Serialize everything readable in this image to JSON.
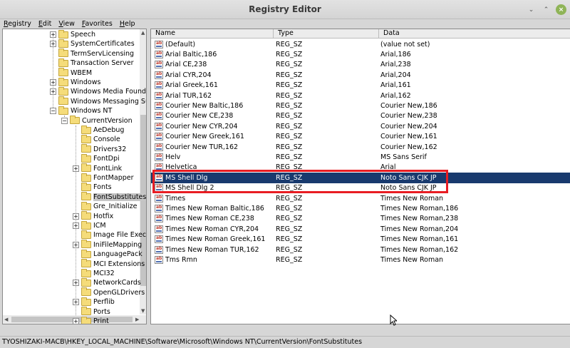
{
  "window": {
    "title": "Registry Editor"
  },
  "menu": [
    "Registry",
    "Edit",
    "View",
    "Favorites",
    "Help"
  ],
  "tree": [
    {
      "label": "Speech",
      "expander": "+",
      "level": 0
    },
    {
      "label": "SystemCertificates",
      "expander": "+",
      "level": 0
    },
    {
      "label": "TermServLicensing",
      "expander": "",
      "level": 0
    },
    {
      "label": "Transaction Server",
      "expander": "",
      "level": 0
    },
    {
      "label": "WBEM",
      "expander": "",
      "level": 0
    },
    {
      "label": "Windows",
      "expander": "+",
      "level": 0
    },
    {
      "label": "Windows Media Founda",
      "expander": "+",
      "level": 0
    },
    {
      "label": "Windows Messaging Sul",
      "expander": "",
      "level": 0
    },
    {
      "label": "Windows NT",
      "expander": "−",
      "level": 0
    },
    {
      "label": "CurrentVersion",
      "expander": "−",
      "level": 1
    },
    {
      "label": "AeDebug",
      "expander": "",
      "level": 2
    },
    {
      "label": "Console",
      "expander": "",
      "level": 2
    },
    {
      "label": "Drivers32",
      "expander": "",
      "level": 2
    },
    {
      "label": "FontDpi",
      "expander": "",
      "level": 2
    },
    {
      "label": "FontLink",
      "expander": "+",
      "level": 2
    },
    {
      "label": "FontMapper",
      "expander": "",
      "level": 2
    },
    {
      "label": "Fonts",
      "expander": "",
      "level": 2
    },
    {
      "label": "FontSubstitutes",
      "expander": "",
      "level": 2,
      "selected": true
    },
    {
      "label": "Gre_Initialize",
      "expander": "",
      "level": 2
    },
    {
      "label": "Hotfix",
      "expander": "+",
      "level": 2
    },
    {
      "label": "ICM",
      "expander": "+",
      "level": 2
    },
    {
      "label": "Image File Exec",
      "expander": "",
      "level": 2
    },
    {
      "label": "IniFileMapping",
      "expander": "+",
      "level": 2
    },
    {
      "label": "LanguagePack",
      "expander": "",
      "level": 2
    },
    {
      "label": "MCI Extensions",
      "expander": "",
      "level": 2
    },
    {
      "label": "MCI32",
      "expander": "",
      "level": 2
    },
    {
      "label": "NetworkCards",
      "expander": "+",
      "level": 2
    },
    {
      "label": "OpenGLDrivers",
      "expander": "",
      "level": 2
    },
    {
      "label": "Perflib",
      "expander": "+",
      "level": 2
    },
    {
      "label": "Ports",
      "expander": "",
      "level": 2
    },
    {
      "label": "Print",
      "expander": "+",
      "level": 2
    }
  ],
  "columns": {
    "name": "Name",
    "type": "Type",
    "data": "Data"
  },
  "values": [
    {
      "name": "(Default)",
      "type": "REG_SZ",
      "data": "(value not set)"
    },
    {
      "name": "Arial Baltic,186",
      "type": "REG_SZ",
      "data": "Arial,186"
    },
    {
      "name": "Arial CE,238",
      "type": "REG_SZ",
      "data": "Arial,238"
    },
    {
      "name": "Arial CYR,204",
      "type": "REG_SZ",
      "data": "Arial,204"
    },
    {
      "name": "Arial Greek,161",
      "type": "REG_SZ",
      "data": "Arial,161"
    },
    {
      "name": "Arial TUR,162",
      "type": "REG_SZ",
      "data": "Arial,162"
    },
    {
      "name": "Courier New Baltic,186",
      "type": "REG_SZ",
      "data": "Courier New,186"
    },
    {
      "name": "Courier New CE,238",
      "type": "REG_SZ",
      "data": "Courier New,238"
    },
    {
      "name": "Courier New CYR,204",
      "type": "REG_SZ",
      "data": "Courier New,204"
    },
    {
      "name": "Courier New Greek,161",
      "type": "REG_SZ",
      "data": "Courier New,161"
    },
    {
      "name": "Courier New TUR,162",
      "type": "REG_SZ",
      "data": "Courier New,162"
    },
    {
      "name": "Helv",
      "type": "REG_SZ",
      "data": "MS Sans Serif"
    },
    {
      "name": "Helvetica",
      "type": "REG_SZ",
      "data": "Arial"
    },
    {
      "name": "MS Shell Dlg",
      "type": "REG_SZ",
      "data": "Noto Sans CJK JP",
      "selected": true
    },
    {
      "name": "MS Shell Dlg 2",
      "type": "REG_SZ",
      "data": "Noto Sans CJK JP"
    },
    {
      "name": "Times",
      "type": "REG_SZ",
      "data": "Times New Roman"
    },
    {
      "name": "Times New Roman Baltic,186",
      "type": "REG_SZ",
      "data": "Times New Roman,186"
    },
    {
      "name": "Times New Roman CE,238",
      "type": "REG_SZ",
      "data": "Times New Roman,238"
    },
    {
      "name": "Times New Roman CYR,204",
      "type": "REG_SZ",
      "data": "Times New Roman,204"
    },
    {
      "name": "Times New Roman Greek,161",
      "type": "REG_SZ",
      "data": "Times New Roman,161"
    },
    {
      "name": "Times New Roman TUR,162",
      "type": "REG_SZ",
      "data": "Times New Roman,162"
    },
    {
      "name": "Tms Rmn",
      "type": "REG_SZ",
      "data": "Times New Roman"
    }
  ],
  "value_icon": "string-value-icon",
  "status": {
    "path": "TYOSHIZAKI-MACB\\HKEY_LOCAL_MACHINE\\Software\\Microsoft\\Windows NT\\CurrentVersion\\FontSubstitutes"
  },
  "colors": {
    "selection": "#193a6e",
    "highlight_box": "#e81d23",
    "close_button": "#8fb457"
  }
}
